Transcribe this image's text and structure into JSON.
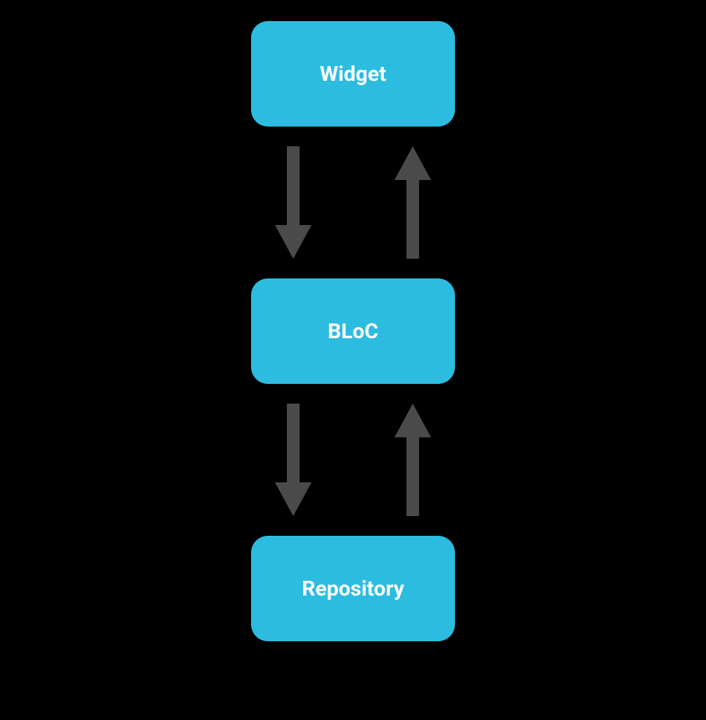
{
  "diagram": {
    "nodes": [
      {
        "id": "widget",
        "label": "Widget"
      },
      {
        "id": "bloc",
        "label": "BLoC"
      },
      {
        "id": "repository",
        "label": "Repository"
      }
    ],
    "colors": {
      "node_bg": "#2cbce0",
      "node_text": "#ffffff",
      "arrow": "#4a4a4a",
      "canvas_bg": "#000000"
    },
    "arrows": [
      {
        "from": "widget",
        "to": "bloc",
        "direction": "down"
      },
      {
        "from": "bloc",
        "to": "widget",
        "direction": "up"
      },
      {
        "from": "bloc",
        "to": "repository",
        "direction": "down"
      },
      {
        "from": "repository",
        "to": "bloc",
        "direction": "up"
      }
    ]
  }
}
